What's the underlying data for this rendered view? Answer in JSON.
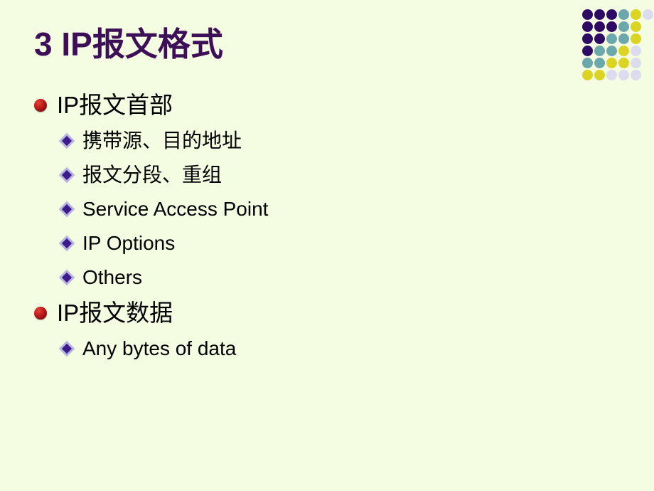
{
  "slide": {
    "background_color": "#f4fce2",
    "title": "3 IP报文格式",
    "title_color": "#3c0f57",
    "body_text_color": "#000000",
    "bullets": [
      {
        "level": 1,
        "marker": "red-sphere-bullet-icon",
        "text": "IP报文首部"
      },
      {
        "level": 2,
        "marker": "purple-diamond-bullet-icon",
        "text": "携带源、目的地址"
      },
      {
        "level": 2,
        "marker": "purple-diamond-bullet-icon",
        "text": "报文分段、重组"
      },
      {
        "level": 2,
        "marker": "purple-diamond-bullet-icon",
        "text": "Service Access Point"
      },
      {
        "level": 2,
        "marker": "purple-diamond-bullet-icon",
        "text": "IP Options"
      },
      {
        "level": 2,
        "marker": "purple-diamond-bullet-icon",
        "text": "Others"
      },
      {
        "level": 1,
        "marker": "red-sphere-bullet-icon",
        "text": "IP报文数据"
      },
      {
        "level": 2,
        "marker": "purple-diamond-bullet-icon",
        "text": "Any bytes of data"
      }
    ],
    "decoration": {
      "name": "dot-grid-decoration",
      "rows": 6,
      "columns": 6,
      "palette": {
        "dark_purple": "#2d0a63",
        "teal": "#6ca7ab",
        "yellow": "#dbd422",
        "pale_lavender": "#dcdcee",
        "background": "#f4fce2"
      },
      "cells": [
        [
          "dark_purple",
          "dark_purple",
          "dark_purple",
          "teal",
          "yellow",
          "pale_lavender"
        ],
        [
          "dark_purple",
          "dark_purple",
          "dark_purple",
          "teal",
          "yellow",
          "background"
        ],
        [
          "dark_purple",
          "dark_purple",
          "teal",
          "teal",
          "yellow",
          "background"
        ],
        [
          "dark_purple",
          "teal",
          "teal",
          "yellow",
          "pale_lavender",
          "background"
        ],
        [
          "teal",
          "teal",
          "yellow",
          "yellow",
          "pale_lavender",
          "background"
        ],
        [
          "yellow",
          "yellow",
          "pale_lavender",
          "pale_lavender",
          "pale_lavender",
          "background"
        ]
      ]
    }
  }
}
